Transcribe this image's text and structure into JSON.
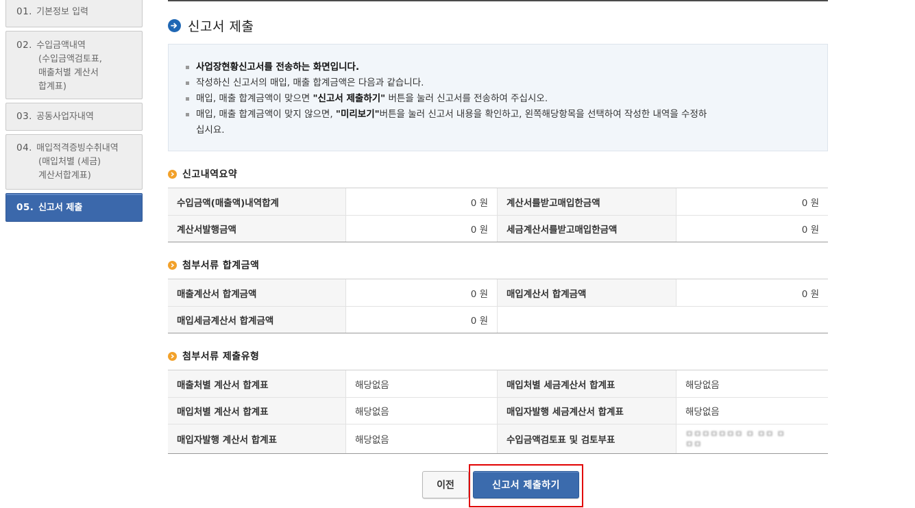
{
  "sidebar": {
    "items": [
      {
        "num": "01.",
        "label": "기본정보 입력",
        "sub": []
      },
      {
        "num": "02.",
        "label": "수입금액내역",
        "sub": [
          "(수입금액검토표,",
          "매출처별 계산서",
          "합계표)"
        ]
      },
      {
        "num": "03.",
        "label": "공동사업자내역",
        "sub": []
      },
      {
        "num": "04.",
        "label": "매입적격증빙수취내역",
        "sub": [
          "(매입처별 (세금)",
          "계산서합계표)"
        ]
      },
      {
        "num": "05.",
        "label": "신고서 제출",
        "sub": []
      }
    ]
  },
  "page": {
    "title": "신고서 제출"
  },
  "notice": {
    "line1": "사업장현황신고서를 전송하는 화면입니다.",
    "line2": "작성하신 신고서의 매입, 매출 합계금액은 다음과 같습니다.",
    "line3_pre": "매입, 매출 합계금액이 맞으면 ",
    "line3_bold": "\"신고서 제출하기\"",
    "line3_post": " 버튼을 눌러 신고서를 전송하여 주십시오.",
    "line4_pre": "매입, 매출 합계금액이 맞지 않으면, ",
    "line4_bold": "\"미리보기\"",
    "line4_post": "버튼을 눌러 신고서 내용을 확인하고, 왼쪽해당항목을 선택하여 작성한 내역을 수정하",
    "line4_cont": "십시요."
  },
  "summary": {
    "title": "신고내역요약",
    "rows": [
      {
        "l1": "수입금액(매출액)내역합계",
        "v1": "0 원",
        "l2": "계산서를받고매입한금액",
        "v2": "0 원"
      },
      {
        "l1": "계산서발행금액",
        "v1": "0 원",
        "l2": "세금계산서를받고매입한금액",
        "v2": "0 원"
      }
    ]
  },
  "attach_amount": {
    "title": "첨부서류 합계금액",
    "rows": [
      {
        "l1": "매출계산서 합계금액",
        "v1": "0 원",
        "l2": "매입계산서 합계금액",
        "v2": "0 원"
      },
      {
        "l1": "매입세금계산서 합계금액",
        "v1": "0 원"
      }
    ]
  },
  "attach_type": {
    "title": "첨부서류 제출유형",
    "rows": [
      {
        "l1": "매출처별 계산서 합계표",
        "v1": "해당없음",
        "l2": "매입처별 세금계산서 합계표",
        "v2": "해당없음"
      },
      {
        "l1": "매입처별 계산서 합계표",
        "v1": "해당없음",
        "l2": "매입자발행 세금계산서 합계표",
        "v2": "해당없음"
      },
      {
        "l1": "매입자발행 계산서 합계표",
        "v1": "해당없음",
        "l2": "수입금액검토표 및 검토부표",
        "v2_line1": "ㅁㅁㅁㅁㅁㅁㅁ ㅁ ㅁㅁ ㅁ",
        "v2_line2": "ㅁㅁ"
      }
    ]
  },
  "buttons": {
    "prev": "이전",
    "submit": "신고서 제출하기"
  },
  "colors": {
    "accent": "#3b68ab",
    "highlight": "#e10000",
    "section_icon": "#f2a12a"
  }
}
